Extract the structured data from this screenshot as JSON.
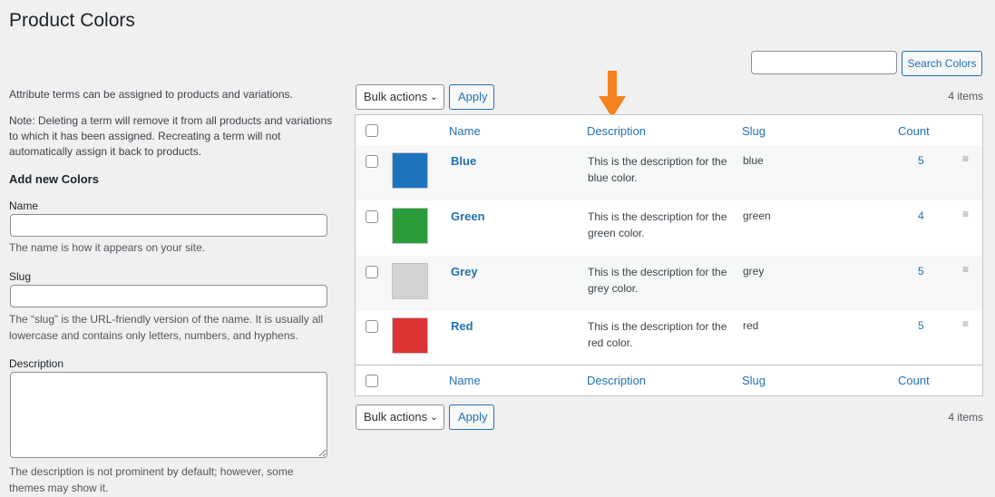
{
  "page": {
    "title": "Product Colors"
  },
  "search": {
    "placeholder": "",
    "button_label": "Search Colors"
  },
  "left": {
    "intro": "Attribute terms can be assigned to products and variations.",
    "note": "Note: Deleting a term will remove it from all products and variations to which it has been assigned. Recreating a term will not automatically assign it back to products.",
    "add_title": "Add new Colors",
    "name_label": "Name",
    "name_help": "The name is how it appears on your site.",
    "slug_label": "Slug",
    "slug_help": "The “slug” is the URL-friendly version of the name. It is usually all lowercase and contains only letters, numbers, and hyphens.",
    "description_label": "Description",
    "description_help": "The description is not prominent by default; however, some themes may show it."
  },
  "bulk": {
    "select_label": "Bulk actions",
    "apply_label": "Apply",
    "items_count": "4 items"
  },
  "table": {
    "columns": {
      "name": "Name",
      "description": "Description",
      "slug": "Slug",
      "count": "Count"
    },
    "rows": [
      {
        "name": "Blue",
        "description": "This is the description for the blue color.",
        "slug": "blue",
        "count": "5",
        "color": "#1e73be"
      },
      {
        "name": "Green",
        "description": "This is the description for the green color.",
        "slug": "green",
        "count": "4",
        "color": "#2a9d3a"
      },
      {
        "name": "Grey",
        "description": "This is the description for the grey color.",
        "slug": "grey",
        "count": "5",
        "color": "#d3d3d3"
      },
      {
        "name": "Red",
        "description": "This is the description for the red color.",
        "slug": "red",
        "count": "5",
        "color": "#dd3333"
      }
    ]
  },
  "annotation": {
    "arrow_color": "#f58220",
    "icon": "down-arrow-icon"
  },
  "icons": {
    "handle": "drag-handle-icon",
    "chevron": "chevron-down-icon"
  }
}
